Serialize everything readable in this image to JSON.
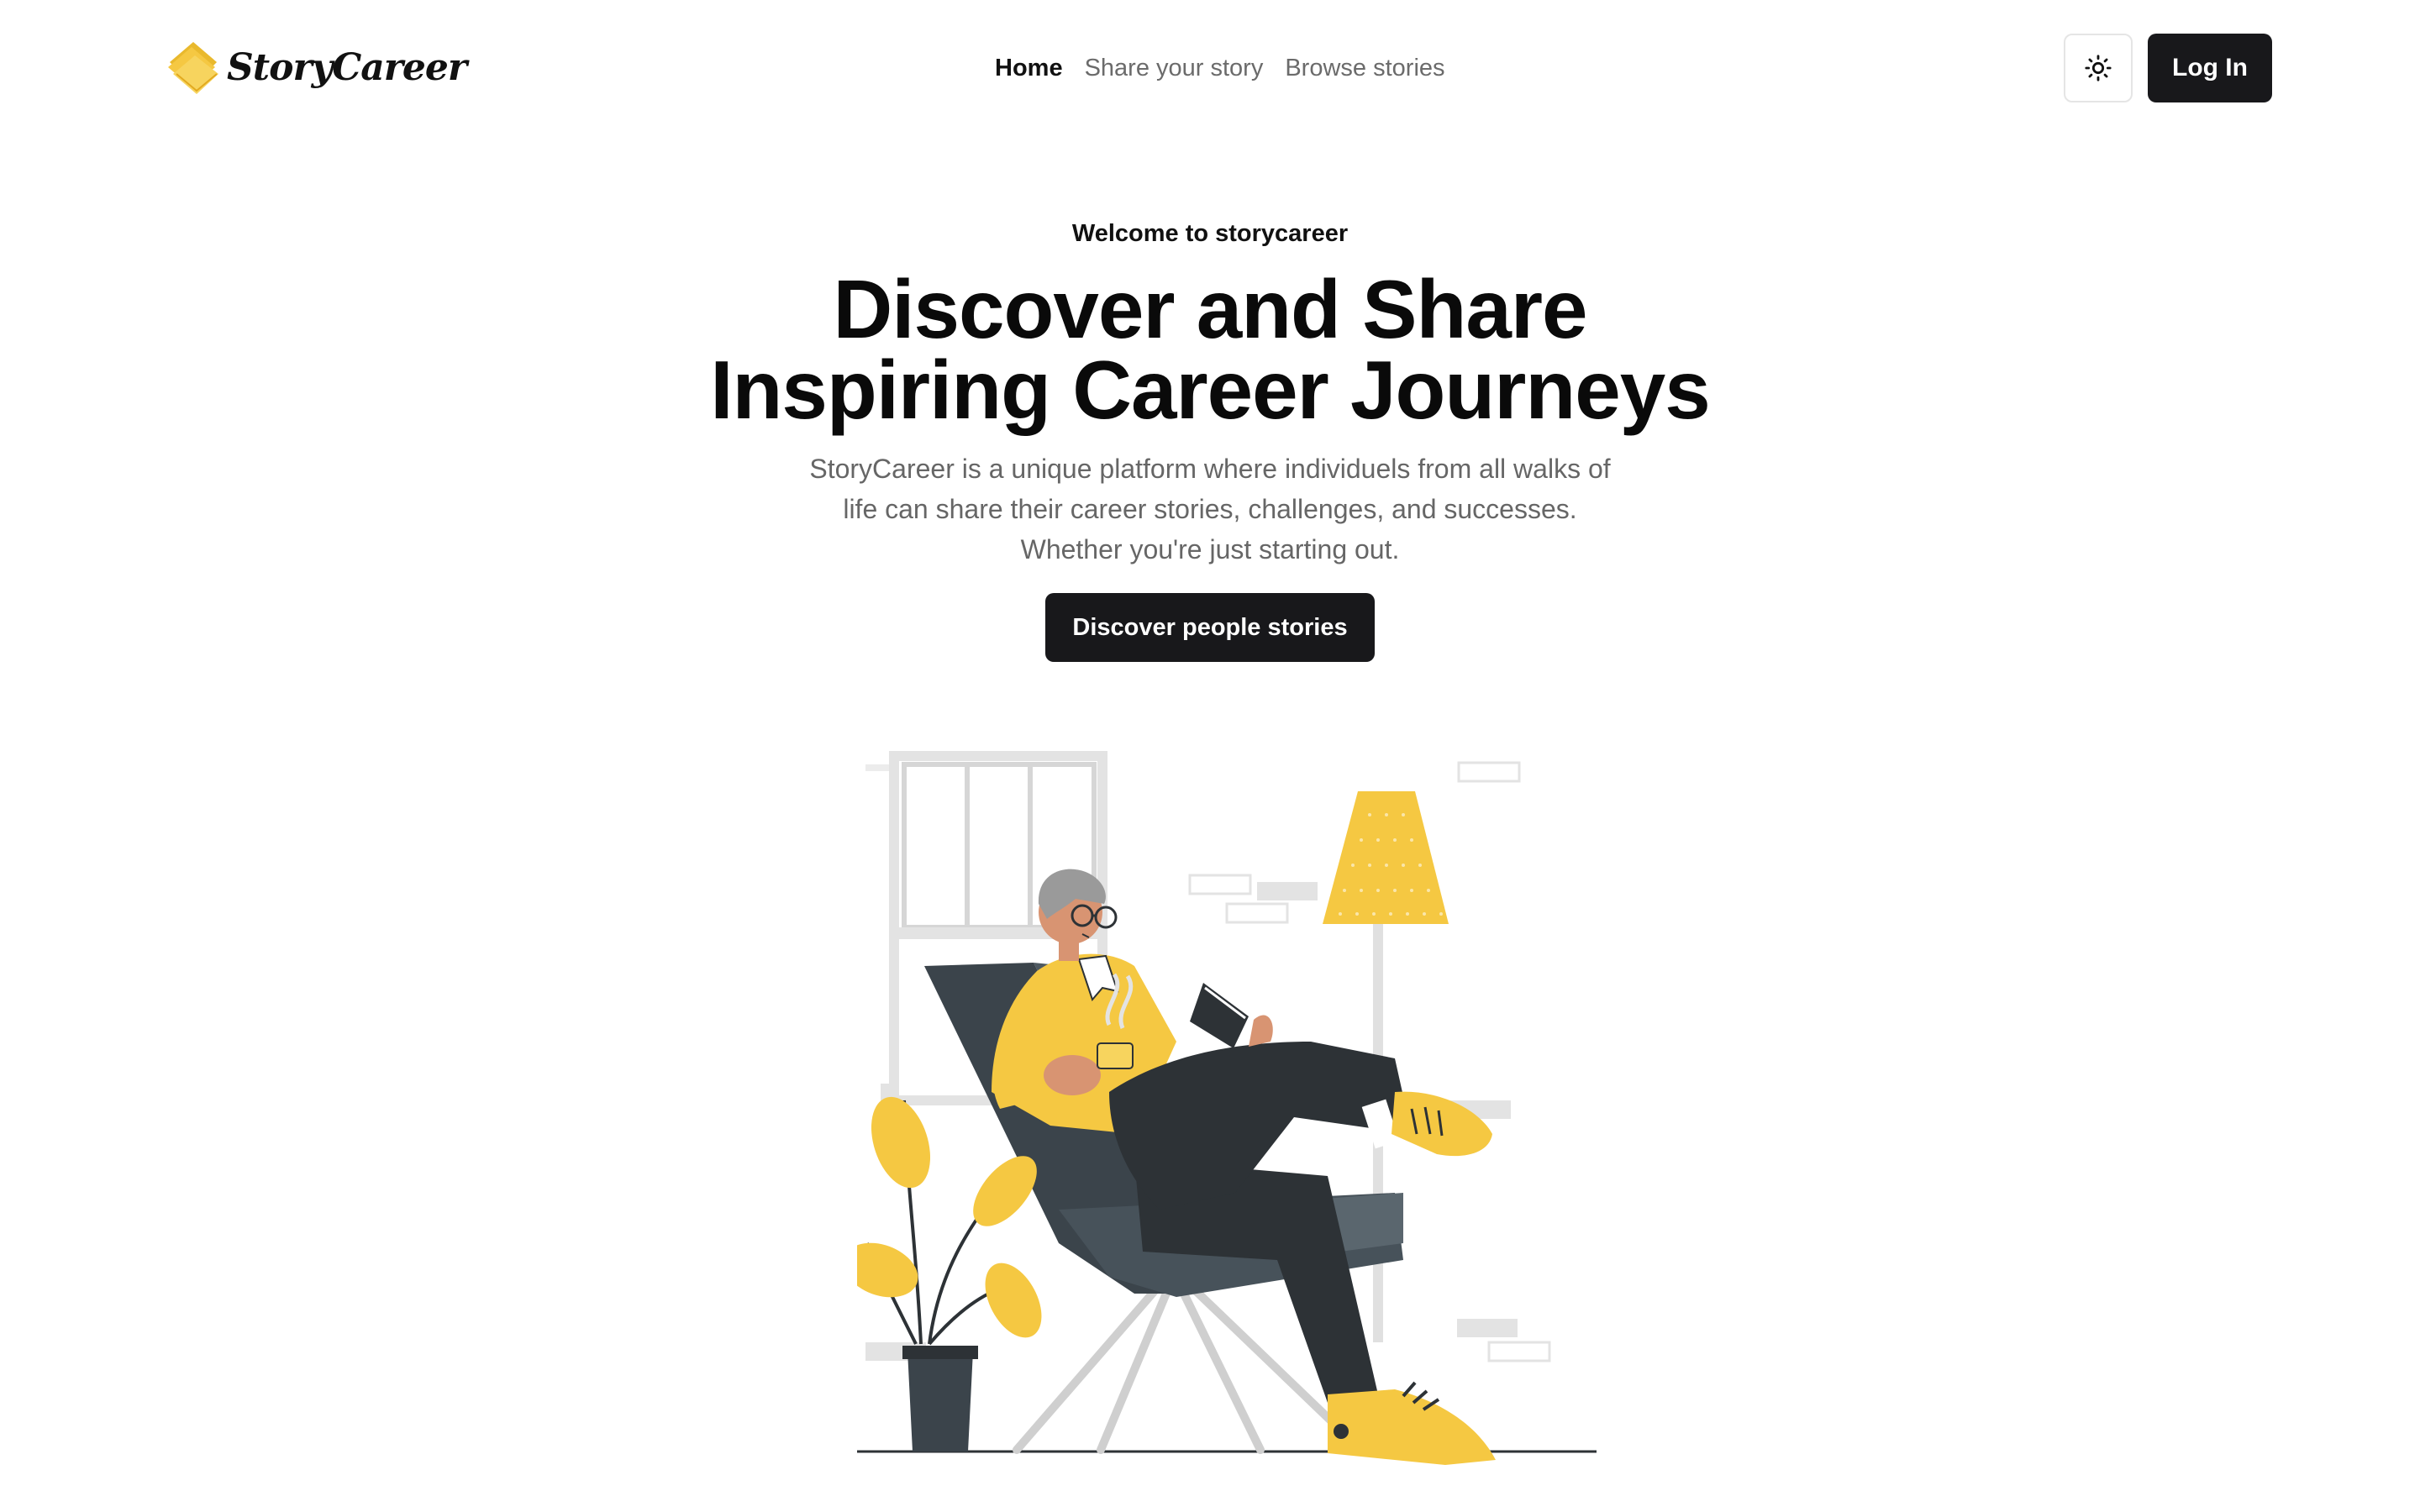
{
  "brand": {
    "name": "StoryCareer",
    "logo_icon": "book-stack-icon",
    "accent_color": "#f5c842"
  },
  "nav": {
    "items": [
      {
        "label": "Home",
        "active": true
      },
      {
        "label": "Share your story",
        "active": false
      },
      {
        "label": "Browse stories",
        "active": false
      }
    ]
  },
  "header": {
    "theme_toggle_icon": "sun-icon",
    "login_label": "Log In"
  },
  "hero": {
    "eyebrow": "Welcome to storycareer",
    "headline_line1": "Discover and Share",
    "headline_line2": "Inspiring Career Journeys",
    "subtext_line1": "StoryCareer is a unique platform where individuels from all walks of",
    "subtext_line2": "life can share their career stories, challenges, and successes.",
    "subtext_line3": "Whether you're just starting out.",
    "cta_label": "Discover people stories"
  },
  "illustration": {
    "subject": "reading-man-armchair-illustration",
    "colors": {
      "yellow": "#f5c842",
      "dark": "#2d3236",
      "chair": "#47525a",
      "gray": "#e3e3e3",
      "skin": "#d89472"
    }
  }
}
